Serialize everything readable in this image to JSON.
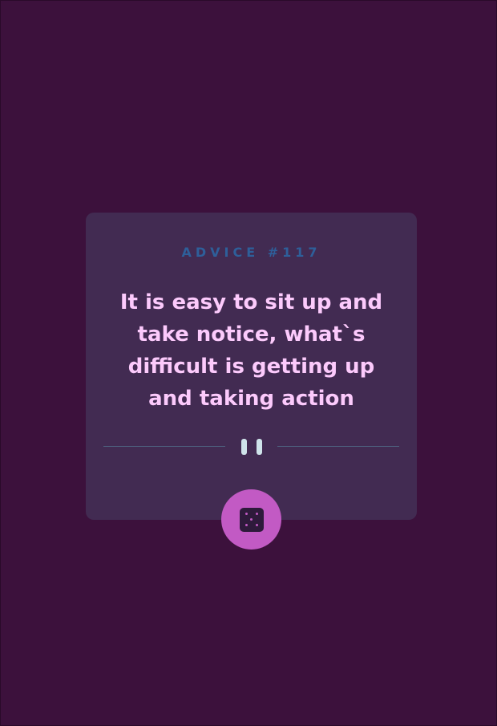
{
  "advice": {
    "id_label": "ADVICE #117",
    "text": "It is easy to sit up and take notice, what`s difficult is getting up and taking action"
  },
  "divider": {
    "icon": "pause-icon"
  },
  "dice_button": {
    "icon": "dice-icon"
  },
  "colors": {
    "background": "#3c113c",
    "card": "#422b52",
    "id_label": "#2e5f9a",
    "advice_text": "#fccafc",
    "button": "#c25ac4"
  }
}
